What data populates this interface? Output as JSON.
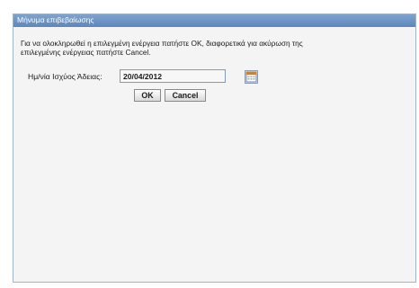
{
  "dialog": {
    "title": "Μήνυμα επιβεβαίωσης",
    "message_line1": "Για να ολοκληρωθεί η επιλεγμένη ενέργεια πατήστε OK, διαφορετικά για ακύρωση της",
    "message_line2": "επιλεγμένης ενέργειας πατήστε Cancel.",
    "date_label": "Ημ/νία Ισχύος Άδειας:",
    "date_value": "20/04/2012",
    "calendar_icon": "calendar-icon",
    "ok_label": "OK",
    "cancel_label": "Cancel"
  },
  "colors": {
    "titlebar": "#6b93c5",
    "panel": "#f4f4f4",
    "border": "#9fb3cb"
  }
}
